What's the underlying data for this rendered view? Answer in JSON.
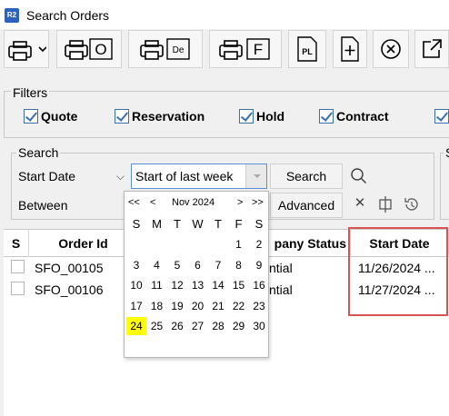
{
  "window": {
    "icon_text": "R2",
    "title": "Search Orders"
  },
  "toolbar": {
    "buttons": [
      {
        "name": "print-icon",
        "badge": ""
      },
      {
        "name": "print-order-icon",
        "badge": "O"
      },
      {
        "name": "print-delivery-icon",
        "badge": "De"
      },
      {
        "name": "print-f-icon",
        "badge": "F"
      },
      {
        "name": "print-packing-list-icon",
        "badge": "PL"
      },
      {
        "name": "new-document-icon",
        "badge": "+"
      },
      {
        "name": "cancel-icon",
        "badge": "×"
      },
      {
        "name": "open-external-icon",
        "badge": ""
      }
    ]
  },
  "filters": {
    "label": "Filters",
    "items": [
      {
        "label": "Quote",
        "checked": true
      },
      {
        "label": "Reservation",
        "checked": true
      },
      {
        "label": "Hold",
        "checked": true
      },
      {
        "label": "Contract",
        "checked": true
      }
    ]
  },
  "search": {
    "label": "Search",
    "right_group_label": "S",
    "field_select": "Start Date",
    "operator_select": "Between",
    "value_input": "Start of last week",
    "search_button": "Search",
    "advanced_button": "Advanced"
  },
  "calendar": {
    "prev_year": "<<",
    "prev_month": "<",
    "month_label": "Nov 2024",
    "next_month": ">",
    "next_year": ">>",
    "weekdays": [
      "S",
      "M",
      "T",
      "W",
      "T",
      "F",
      "S"
    ],
    "weeks": [
      [
        "",
        "",
        "",
        "",
        "",
        "1",
        "2"
      ],
      [
        "3",
        "4",
        "5",
        "6",
        "7",
        "8",
        "9"
      ],
      [
        "10",
        "11",
        "12",
        "13",
        "14",
        "15",
        "16"
      ],
      [
        "17",
        "18",
        "19",
        "20",
        "21",
        "22",
        "23"
      ],
      [
        "24",
        "25",
        "26",
        "27",
        "28",
        "29",
        "30"
      ]
    ],
    "highlighted_day": "24",
    "highlight_color": "#ffff00"
  },
  "grid": {
    "columns": [
      "S",
      "Order Id",
      "Company Status",
      "Start Date"
    ],
    "status_header_visible": "pany Status",
    "rows": [
      {
        "order_id": "SFO_00105",
        "status": "ntial",
        "start_date": "11/26/2024 ..."
      },
      {
        "order_id": "SFO_00106",
        "status": "ntial",
        "start_date": "11/27/2024 ..."
      }
    ]
  },
  "colors": {
    "highlight_border": "#d9534f",
    "checkbox": "#3a6fb0"
  }
}
